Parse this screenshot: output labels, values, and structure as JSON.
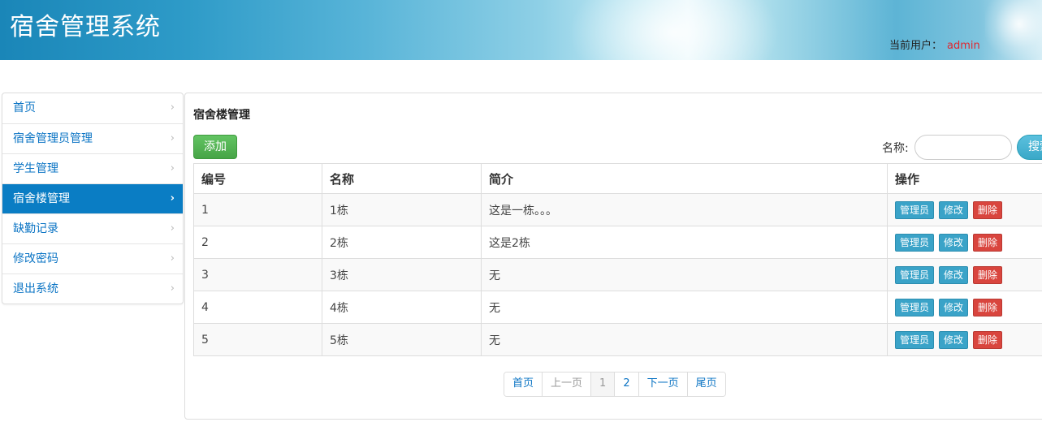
{
  "header": {
    "title": "宿舍管理系统",
    "user_label": "当前用户：",
    "user_name": "admin"
  },
  "sidebar": {
    "items": [
      {
        "label": "首页",
        "active": false
      },
      {
        "label": "宿舍管理员管理",
        "active": false
      },
      {
        "label": "学生管理",
        "active": false
      },
      {
        "label": "宿舍楼管理",
        "active": true
      },
      {
        "label": "缺勤记录",
        "active": false
      },
      {
        "label": "修改密码",
        "active": false
      },
      {
        "label": "退出系统",
        "active": false
      }
    ],
    "chevron": "›"
  },
  "main": {
    "heading": "宿舍楼管理",
    "add_label": "添加",
    "search_label": "名称:",
    "search_value": "",
    "search_button": "搜索",
    "table": {
      "headers": [
        "编号",
        "名称",
        "简介",
        "操作"
      ],
      "rows": [
        {
          "id": "1",
          "name": "1栋",
          "desc": "这是一栋。。。"
        },
        {
          "id": "2",
          "name": "2栋",
          "desc": "这是2栋"
        },
        {
          "id": "3",
          "name": "3栋",
          "desc": "无"
        },
        {
          "id": "4",
          "name": "4栋",
          "desc": "无"
        },
        {
          "id": "5",
          "name": "5栋",
          "desc": "无"
        }
      ],
      "actions": {
        "manager": "管理员",
        "edit": "修改",
        "delete": "删除"
      }
    },
    "pagination": {
      "first": "首页",
      "prev": "上一页",
      "pages": [
        "1",
        "2"
      ],
      "current": "1",
      "next": "下一页",
      "last": "尾页"
    }
  },
  "colors": {
    "accent": "#0a7dc4",
    "add_button": "#5cb85c",
    "action_button": "#3aa3c8",
    "delete_button": "#d9453e",
    "username": "#e0262f"
  }
}
